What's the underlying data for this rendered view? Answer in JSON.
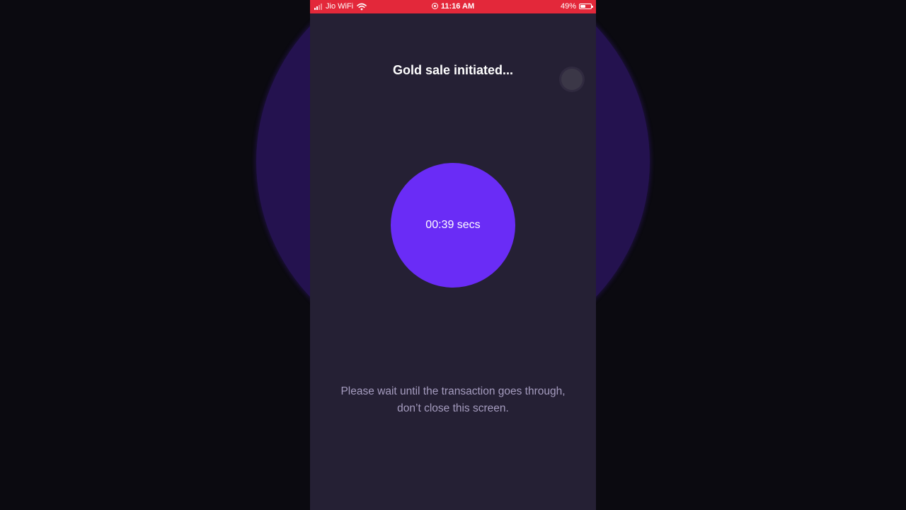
{
  "status_bar": {
    "carrier": "Jio WiFi",
    "time": "11:16 AM",
    "battery_percent": "49%",
    "battery_level": 0.49,
    "icons": [
      "signal-icon",
      "wifi-icon",
      "screen-record-icon",
      "battery-icon"
    ],
    "background_color": "#e3283a"
  },
  "screen": {
    "title": "Gold sale initiated...",
    "timer": {
      "text": "00:39 secs",
      "color": "#6a2cf6"
    },
    "message": {
      "line1": "Please wait until the transaction goes through,",
      "line2": "don’t close this screen."
    },
    "background_color": "#252034"
  }
}
